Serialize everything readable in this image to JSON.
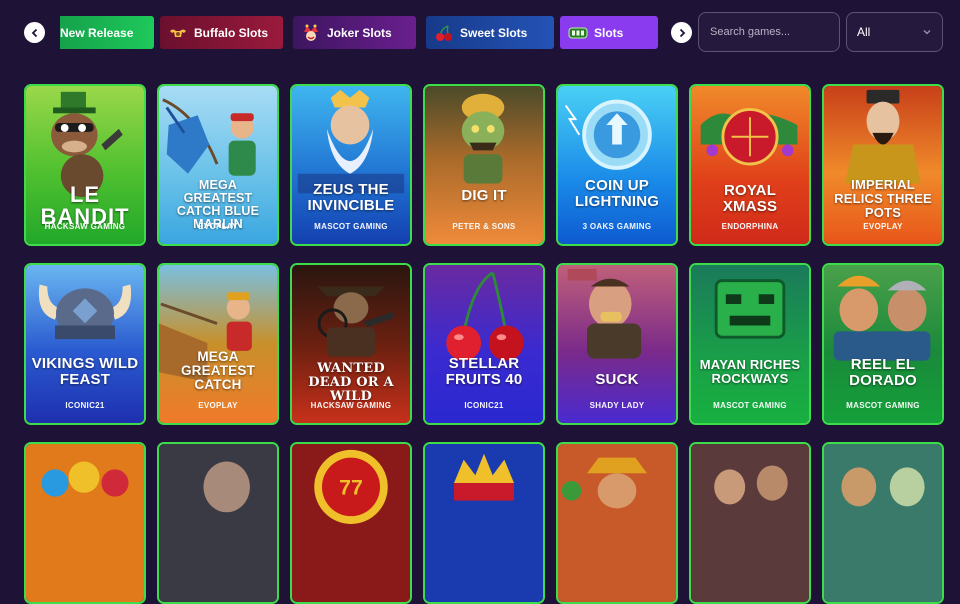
{
  "nav": {
    "prev_label": "previous",
    "next_label": "next",
    "tabs": [
      {
        "label": "New Release",
        "icon": "sparkle-icon"
      },
      {
        "label": "Buffalo Slots",
        "icon": "buffalo-icon"
      },
      {
        "label": "Joker Slots",
        "icon": "joker-icon"
      },
      {
        "label": "Sweet Slots",
        "icon": "cherry-icon"
      },
      {
        "label": "Slots",
        "icon": "slot-machine-icon"
      }
    ]
  },
  "search": {
    "placeholder": "Search games..."
  },
  "filter": {
    "selected": "All"
  },
  "colors": {
    "background": "#1e1236",
    "card_border": "#3ddc4a",
    "active_tab": "#8a3bf0"
  },
  "games": [
    {
      "title": "LE BANDIT",
      "provider": "HACKSAW GAMING"
    },
    {
      "title": "MEGA GREATEST CATCH BLUE MARLIN",
      "provider": "EVOPLAY"
    },
    {
      "title": "ZEUS THE INVINCIBLE",
      "provider": "MASCOT GAMING"
    },
    {
      "title": "DIG IT",
      "provider": "PETER & SONS"
    },
    {
      "title": "COIN UP LIGHTNING",
      "provider": "3 OAKS GAMING"
    },
    {
      "title": "ROYAL XMASS",
      "provider": "ENDORPHINA"
    },
    {
      "title": "IMPERIAL RELICS THREE POTS",
      "provider": "EVOPLAY"
    },
    {
      "title": "VIKINGS WILD FEAST",
      "provider": "ICONIC21"
    },
    {
      "title": "MEGA GREATEST CATCH",
      "provider": "EVOPLAY"
    },
    {
      "title": "WANTED DEAD OR A WILD",
      "provider": "HACKSAW GAMING"
    },
    {
      "title": "STELLAR FRUITS 40",
      "provider": "ICONIC21"
    },
    {
      "title": "SUCK",
      "provider": "SHADY LADY"
    },
    {
      "title": "MAYAN RICHES ROCKWAYS",
      "provider": "MASCOT GAMING"
    },
    {
      "title": "REEL EL DORADO",
      "provider": "MASCOT GAMING"
    },
    {
      "title": "",
      "provider": ""
    },
    {
      "title": "",
      "provider": ""
    },
    {
      "title": "",
      "provider": ""
    },
    {
      "title": "",
      "provider": ""
    },
    {
      "title": "",
      "provider": ""
    },
    {
      "title": "",
      "provider": ""
    },
    {
      "title": "",
      "provider": ""
    }
  ]
}
